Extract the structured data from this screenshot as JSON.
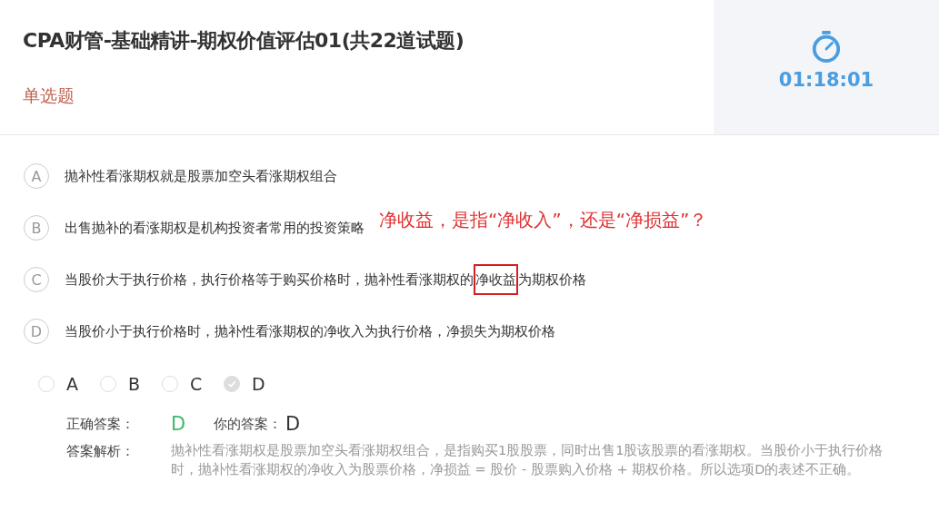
{
  "header": {
    "title": "CPA财管-基础精讲-期权价值评估01(共22道试题)",
    "question_type": "单选题",
    "timer": "01:18:01"
  },
  "options": [
    {
      "letter": "A",
      "segments": [
        {
          "kind": "plain",
          "text": "抛补性看涨期权就是股票加空头看涨期权组合"
        }
      ]
    },
    {
      "letter": "B",
      "segments": [
        {
          "kind": "plain",
          "text": "出售抛补的看涨期权是机构投资者常用的投资策略"
        }
      ]
    },
    {
      "letter": "C",
      "segments": [
        {
          "kind": "plain",
          "text": "当股价大于执行价格，执行价格等于购买价格时，抛补性看涨期权的"
        },
        {
          "kind": "boxed",
          "text": "净收益"
        },
        {
          "kind": "plain",
          "text": "为期权价格"
        }
      ]
    },
    {
      "letter": "D",
      "segments": [
        {
          "kind": "plain",
          "text": "当股价小于执行价格时，抛补性看涨期权的净收入为执行价格，净损失为期权价格"
        }
      ]
    }
  ],
  "annotation": "净收益，是指“净收入”，还是“净损益”？",
  "choices": [
    {
      "label": "A",
      "selected": false
    },
    {
      "label": "B",
      "selected": false
    },
    {
      "label": "C",
      "selected": false
    },
    {
      "label": "D",
      "selected": true
    }
  ],
  "result": {
    "correct_label": "正确答案：",
    "correct_answer": "D",
    "your_label": "你的答案：",
    "your_answer": "D",
    "analysis_label": "答案解析：",
    "analysis": "抛补性看涨期权是股票加空头看涨期权组合，是指购买1股股票，同时出售1股该股票的看涨期权。当股价小于执行价格时，抛补性看涨期权的净收入为股票价格，净损益 = 股价 - 股票购入价格 + 期权价格。所以选项D的表述不正确。"
  }
}
